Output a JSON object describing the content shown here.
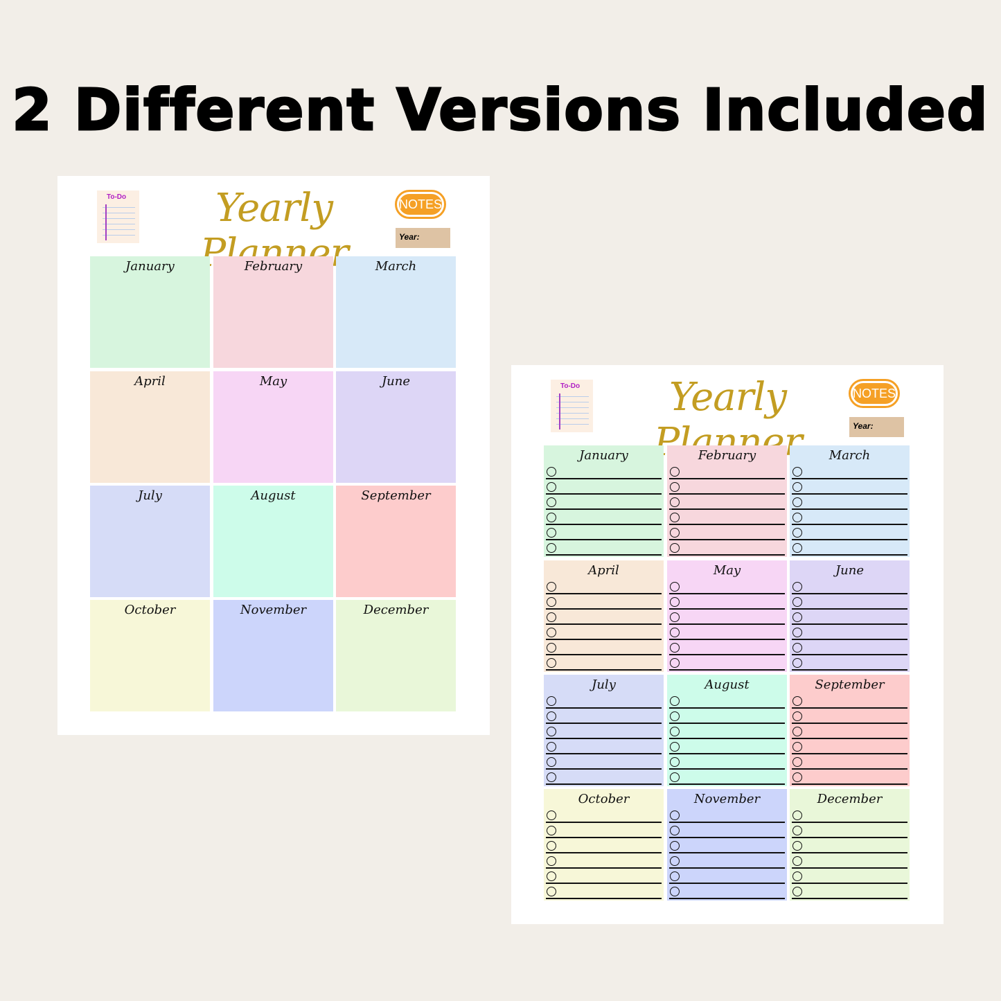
{
  "headline": "2 Different Versions Included",
  "planner": {
    "title": "Yearly Planner",
    "todo_label": "To-Do",
    "notes_label": "NOTES",
    "year_label": "Year:",
    "checkbox_rows": 6,
    "months": [
      {
        "name": "January",
        "color": "#d7f5de"
      },
      {
        "name": "February",
        "color": "#f7d7dd"
      },
      {
        "name": "March",
        "color": "#d7e9f8"
      },
      {
        "name": "April",
        "color": "#f8e8d8"
      },
      {
        "name": "May",
        "color": "#f7d6f5"
      },
      {
        "name": "June",
        "color": "#ddd6f6"
      },
      {
        "name": "July",
        "color": "#d6dcf7"
      },
      {
        "name": "August",
        "color": "#cdfcea"
      },
      {
        "name": "September",
        "color": "#fdcccc"
      },
      {
        "name": "October",
        "color": "#f7f7d8"
      },
      {
        "name": "November",
        "color": "#ccd5fb"
      },
      {
        "name": "December",
        "color": "#e9f7d9"
      }
    ]
  }
}
